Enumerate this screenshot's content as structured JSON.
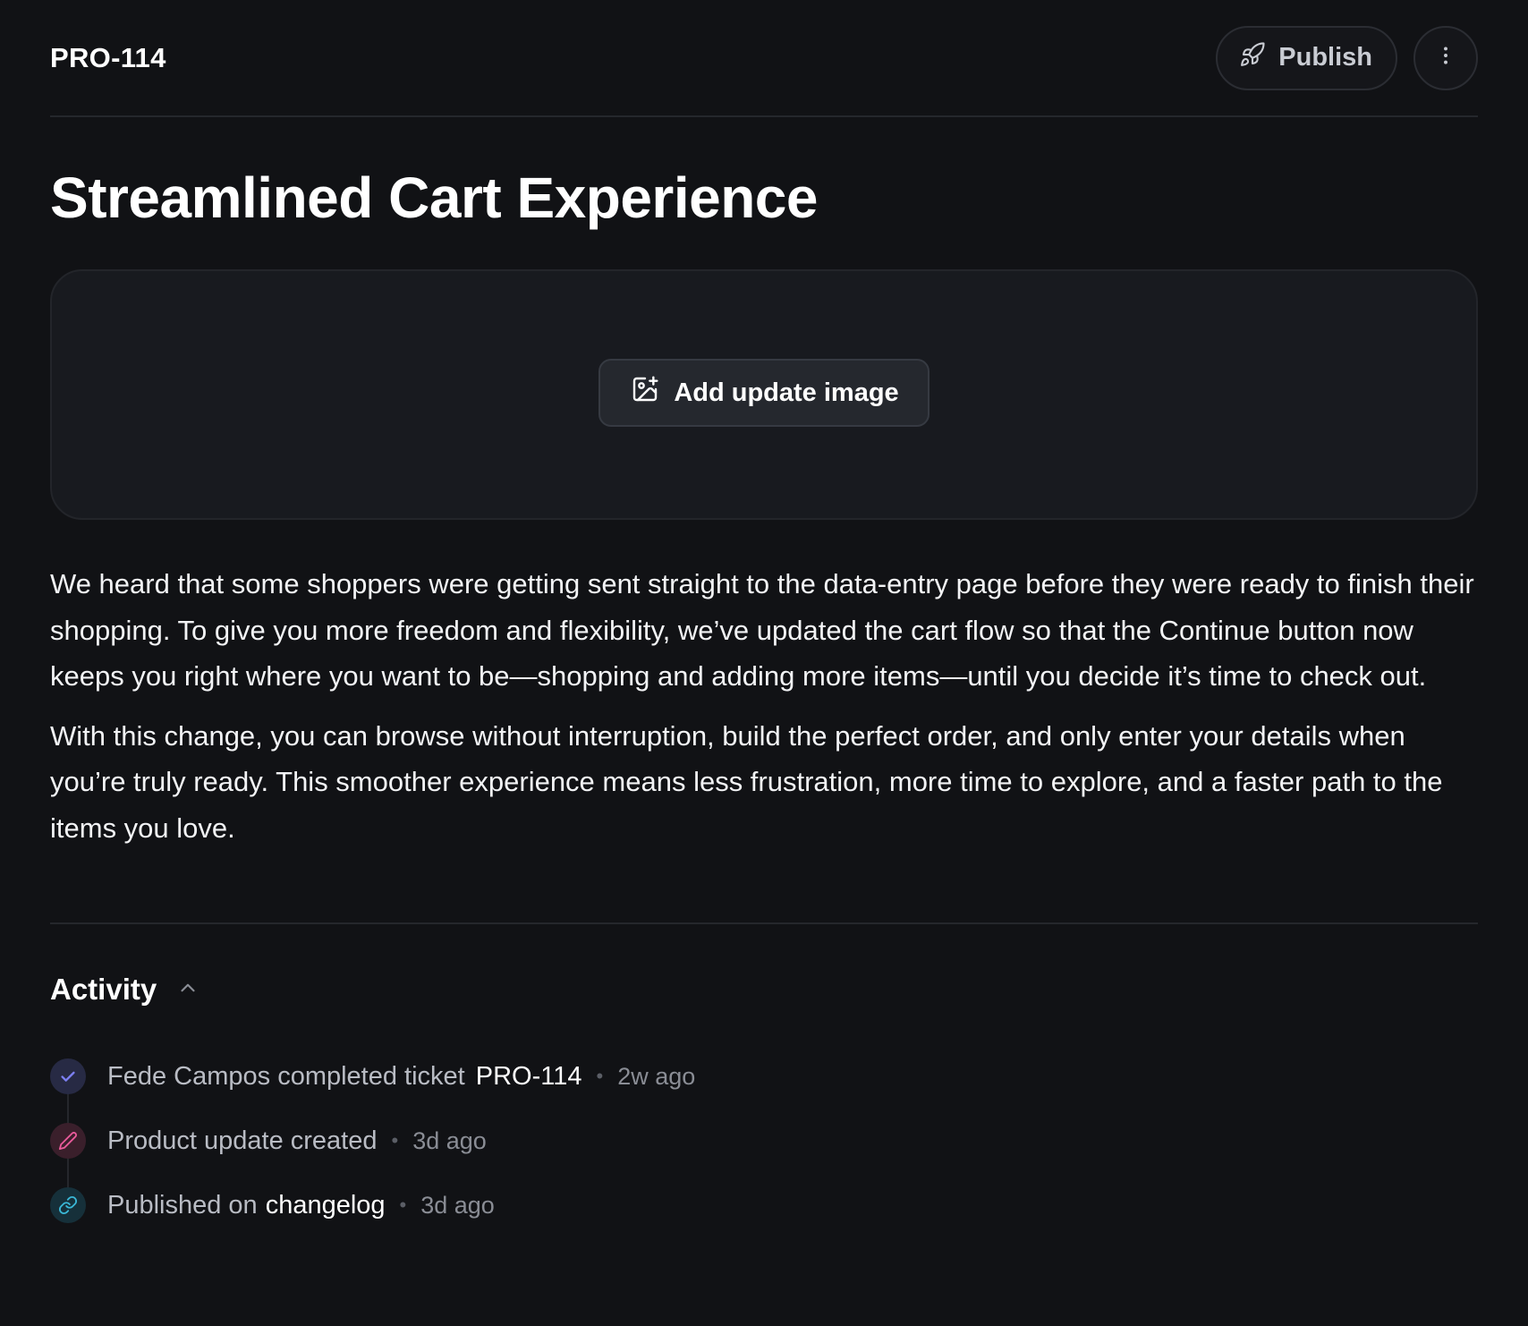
{
  "header": {
    "ticket_id": "PRO-114",
    "publish_label": "Publish"
  },
  "update": {
    "title": "Streamlined Cart Experience",
    "add_image_label": "Add update image",
    "paragraphs": [
      "We heard that some shoppers were getting sent straight to the data-entry page before they were ready to finish their shopping. To give you more freedom and flexibility, we’ve updated the cart flow so that the Continue button now keeps you right where you want to be—shopping and adding more items—until you decide it’s time to check out.",
      "With this change, you can browse without interruption, build the perfect order, and only enter your details when you’re truly ready. This smoother experience means less frustration, more time to explore, and a faster path to the items you love."
    ]
  },
  "activity": {
    "title": "Activity",
    "items": [
      {
        "icon": "check-icon",
        "text": "Fede Campos completed ticket",
        "strong": "PRO-114",
        "time": "2w ago",
        "color": "#7c7ff2"
      },
      {
        "icon": "pencil-icon",
        "text": "Product update created",
        "time": "3d ago",
        "color": "#e85a9a"
      },
      {
        "icon": "link-icon",
        "text": "Published on",
        "link": "changelog",
        "time": "3d ago",
        "color": "#3ab7d6"
      }
    ]
  }
}
